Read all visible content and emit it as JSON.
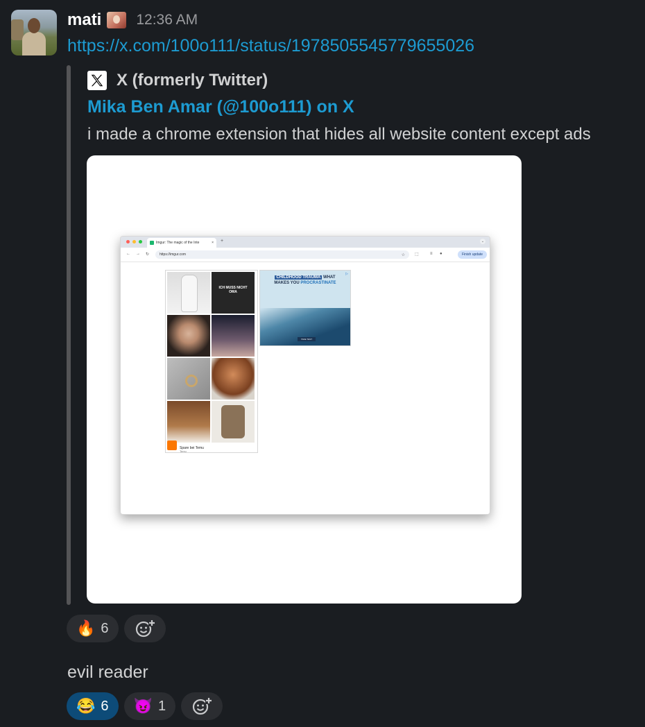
{
  "message1": {
    "username": "mati",
    "timestamp": "12:36 AM",
    "link": "https://x.com/100o111/status/1978505545779655026",
    "unfurl": {
      "source": "X (formerly Twitter)",
      "title": "Mika Ben Amar (@100o111) on X",
      "text": "i made a chrome extension that hides all website content except ads",
      "screenshot": {
        "tab_title": "Imgur: The magic of the Inte",
        "tab_close": "×",
        "new_tab": "+",
        "url": "https://imgur.com",
        "update_button": "Finish update",
        "ads": {
          "temu_title": "Spare bei Temu",
          "temu_sub": "Temu",
          "temu_logo": "Temu",
          "ad2_title_a": "CHILDHOOD TRAUMA",
          "ad2_title_b": "WHAT",
          "ad2_title_c": "MAKES YOU",
          "ad2_title_d": "PROCRASTINATE",
          "ad2_button": "TAKE TEST",
          "shirt_text": "ICH MUSS NICHT OMA"
        }
      }
    },
    "reactions": [
      {
        "emoji": "🔥",
        "count": "6"
      }
    ]
  },
  "message2": {
    "text": "evil reader",
    "reactions": [
      {
        "emoji": "😂",
        "count": "6",
        "active": true
      },
      {
        "emoji": "😈",
        "count": "1",
        "active": false
      }
    ]
  },
  "icons": {
    "add_reaction": "add-reaction-icon"
  },
  "colors": {
    "background": "#1a1d21",
    "link": "#1d9bd1",
    "active_reaction": "#0d4b78",
    "reaction_pill": "#2b2d31"
  }
}
